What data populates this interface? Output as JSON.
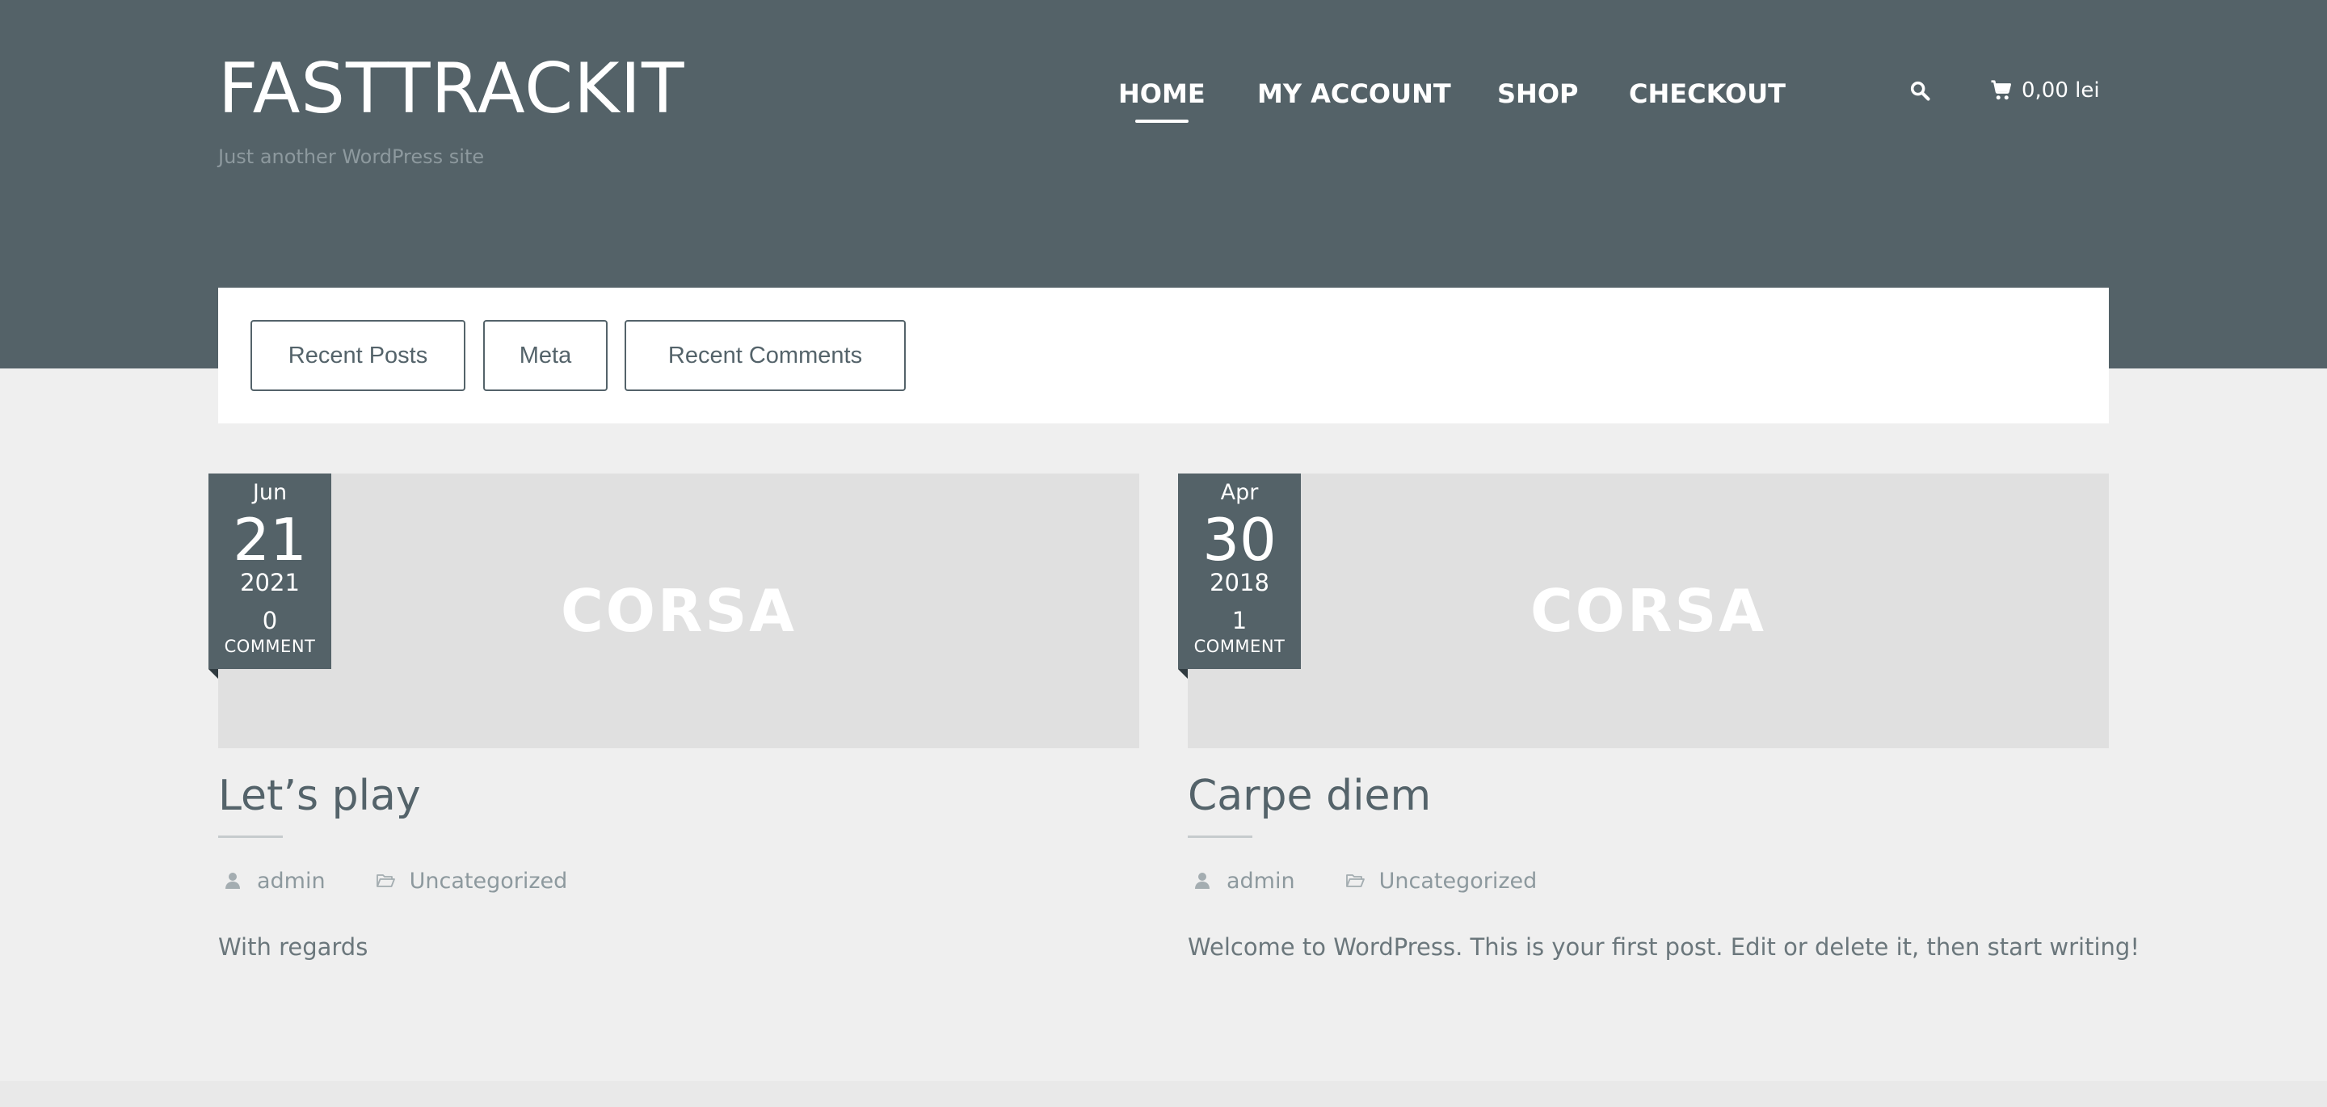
{
  "site": {
    "title": "FASTTRACKIT",
    "tagline": "Just another WordPress site"
  },
  "nav": {
    "items": [
      {
        "label": "HOME",
        "active": true
      },
      {
        "label": "MY ACCOUNT",
        "active": false
      },
      {
        "label": "SHOP",
        "active": false
      },
      {
        "label": "CHECKOUT",
        "active": false
      }
    ],
    "search_icon": "search-icon",
    "cart": {
      "icon": "cart-icon",
      "total": "0,00 lei"
    }
  },
  "widget_tabs": [
    "Recent Posts",
    "Meta",
    "Recent Comments"
  ],
  "posts": [
    {
      "month": "Jun",
      "day": "21",
      "year": "2021",
      "comment_count": "0",
      "comment_label": "COMMENT",
      "thumbnail_text": "CORSA",
      "title": "Let’s play",
      "author": "admin",
      "category": "Uncategorized",
      "excerpt": "With regards"
    },
    {
      "month": "Apr",
      "day": "30",
      "year": "2018",
      "comment_count": "1",
      "comment_label": "COMMENT",
      "thumbnail_text": "CORSA",
      "title": "Carpe diem",
      "author": "admin",
      "category": "Uncategorized",
      "excerpt": "Welcome to WordPress. This is your first post. Edit or delete it, then start writing!"
    }
  ],
  "colors": {
    "header_bg": "#546268",
    "page_bg": "#efefef",
    "thumbnail_bg": "#e0e0e0",
    "text": "#54636a",
    "muted": "#8d999e"
  }
}
